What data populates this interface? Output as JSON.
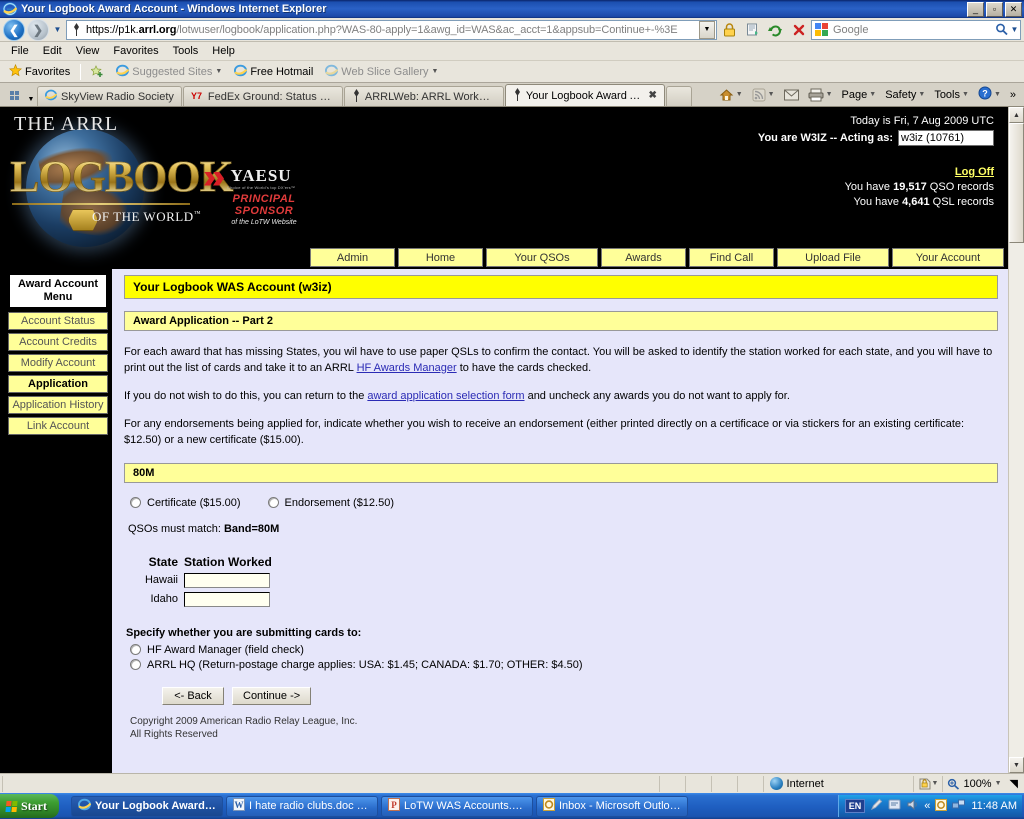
{
  "window": {
    "title": "Your Logbook Award Account - Windows Internet Explorer",
    "minimize": "_",
    "maximize": "▫",
    "close": "✕"
  },
  "address_bar": {
    "url_protocol": "https://",
    "url_host_pre": "p1k.",
    "url_host_bold": "arrl.org",
    "url_path": "/lotwuser/logbook/application.php?WAS-80-apply=1&awg_id=WAS&ac_acct=1&appsub=Continue+-%3E",
    "full_url": "https://p1k.arrl.org/lotwuser/logbook/application.php?WAS-80-apply=1&awg_id=WAS&ac_acct=1&appsub=Continue+-%3E",
    "search_placeholder": "Google",
    "back_tooltip": "Back",
    "forward_tooltip": "Forward"
  },
  "menubar": [
    "File",
    "Edit",
    "View",
    "Favorites",
    "Tools",
    "Help"
  ],
  "favorites_bar": {
    "favorites_label": "Favorites",
    "items": [
      {
        "label": "Suggested Sites",
        "has_caret": true,
        "dim": true
      },
      {
        "label": "Free Hotmail",
        "has_caret": false,
        "dim": false
      },
      {
        "label": "Web Slice Gallery",
        "has_caret": true,
        "dim": true
      }
    ]
  },
  "tabs": [
    {
      "label": "SkyView Radio Society",
      "active": false,
      "icon": "ie-icon"
    },
    {
      "label": "FedEx Ground: Status of Shi...",
      "active": false,
      "icon": "fedex-icon"
    },
    {
      "label": "ARRLWeb: ARRL Worked All ...",
      "active": false,
      "icon": "arrl-icon"
    },
    {
      "label": "Your Logbook Award Acc...",
      "active": true,
      "icon": "arrl-icon",
      "close": "✖"
    }
  ],
  "command_bar": [
    {
      "label": "Page",
      "icon": "page-icon"
    },
    {
      "label": "Safety",
      "icon": "safety-icon"
    },
    {
      "label": "Tools",
      "icon": "tools-icon"
    },
    {
      "label": "Help",
      "icon": "help-icon"
    },
    {
      "label": "»",
      "icon": "chevron-overflow-icon"
    }
  ],
  "site_header": {
    "brand_top": "THE ARRL",
    "brand_main": "LOGBOOK",
    "brand_sub": "OF THE WORLD",
    "brand_tm": "™",
    "sponsor_name": "YAESU",
    "sponsor_tagline": "Choice of the World's top DX'ers™",
    "sponsor_role_line1": "PRINCIPAL",
    "sponsor_role_line2": "SPONSOR",
    "sponsor_role_line3": "of the LoTW Website",
    "today": "Today is Fri, 7 Aug 2009 UTC",
    "acting_label": "You are W3IZ -- Acting as:",
    "acting_value": "w3iz  (10761)",
    "logoff": "Log Off",
    "qso_prefix": "You have ",
    "qso_count": "19,517",
    "qso_suffix": " QSO records",
    "qsl_prefix": "You have ",
    "qsl_count": "4,641",
    "qsl_suffix": " QSL records"
  },
  "nav": [
    {
      "label": "Admin"
    },
    {
      "label": "Home"
    },
    {
      "label": "Your QSOs"
    },
    {
      "label": "Awards"
    },
    {
      "label": "Find Call"
    },
    {
      "label": "Upload File"
    },
    {
      "label": "Your Account"
    }
  ],
  "sidebar": {
    "title_line1": "Award Account",
    "title_line2": "Menu",
    "items": [
      {
        "label": "Account Status",
        "active": false
      },
      {
        "label": "Account Credits",
        "active": false
      },
      {
        "label": "Modify Account",
        "active": false
      },
      {
        "label": "Application",
        "active": true
      },
      {
        "label": "Application History",
        "active": false
      },
      {
        "label": "Link Account",
        "active": false
      }
    ]
  },
  "main": {
    "page_title": "Your Logbook WAS Account (w3iz)",
    "section_title": "Award Application -- Part 2",
    "para1_a": "For each award that has missing States, you wil have to use paper QSLs to confirm the contact. You will be asked to identify the station worked for each state, and you will have to print out the list of cards and take it to an ARRL ",
    "para1_link": "HF Awards Manager",
    "para1_b": " to have the cards checked.",
    "para2_a": "If you do not wish to do this, you can return to the ",
    "para2_link": "award application selection form",
    "para2_b": " and uncheck any awards you do not want to apply for.",
    "para3": "For any endorsements being applied for, indicate whether you wish to receive an endorsement (either printed directly on a certificace or via stickers for an existing certificate: $12.50) or a new certificate ($15.00).",
    "band_header": "80M",
    "cert_option": "Certificate ($15.00)",
    "endorsement_option": "Endorsement ($12.50)",
    "match_label": "QSOs must match: ",
    "match_value": "Band=80M",
    "table_headers": [
      "State",
      "Station Worked"
    ],
    "rows": [
      {
        "state": "Hawaii",
        "station": ""
      },
      {
        "state": "Idaho",
        "station": ""
      }
    ],
    "submit_header": "Specify whether you are submitting cards to:",
    "submit_options": [
      "HF Award Manager (field check)",
      "ARRL HQ (Return-postage charge applies: USA: $1.45; CANADA: $1.70; OTHER: $4.50)"
    ],
    "back_button": "<- Back",
    "continue_button": "Continue ->",
    "copyright_line1": "Copyright 2009 American Radio Relay League, Inc.",
    "copyright_line2": "All Rights Reserved"
  },
  "status_bar": {
    "zone": "Internet",
    "zoom": "100%"
  },
  "taskbar": {
    "start": "Start",
    "tasks": [
      {
        "label": "Your Logbook Award ...",
        "icon": "ie-icon",
        "active": true
      },
      {
        "label": "I hate radio clubs.doc - ...",
        "icon": "word-icon",
        "active": false
      },
      {
        "label": "LoTW WAS Accounts.ppt",
        "icon": "powerpoint-icon",
        "active": false
      },
      {
        "label": "Inbox - Microsoft Outlook",
        "icon": "outlook-icon",
        "active": false
      }
    ],
    "lang": "EN",
    "clock": "11:48 AM"
  },
  "colors": {
    "titlebar_blue": "#1c4fb0",
    "page_background": "#e6e6fa",
    "accent_yellow": "#ffff00",
    "light_yellow": "#ffff99",
    "link_blue": "#2b2bb5",
    "logoff_yellow": "#ffff66",
    "black_header": "#000000"
  }
}
